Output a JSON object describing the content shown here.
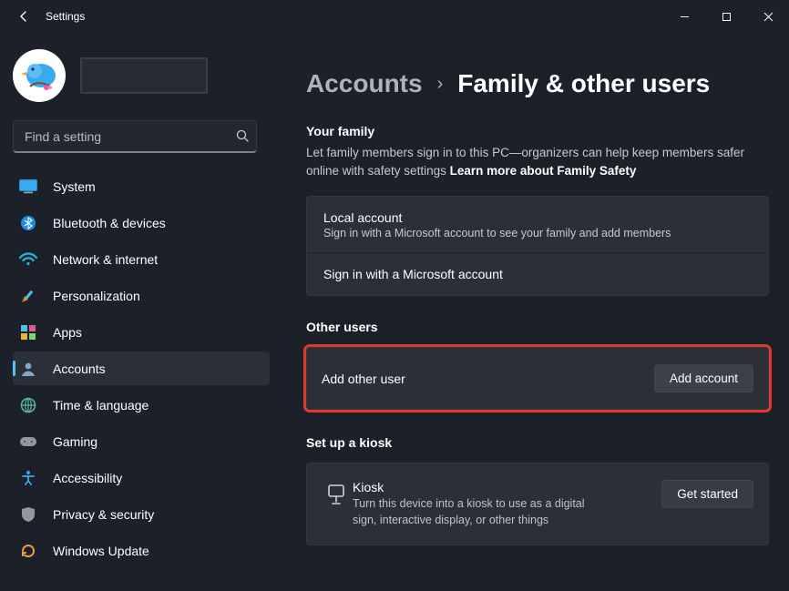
{
  "window": {
    "title": "Settings"
  },
  "search": {
    "placeholder": "Find a setting"
  },
  "nav": {
    "items": [
      {
        "label": "System"
      },
      {
        "label": "Bluetooth & devices"
      },
      {
        "label": "Network & internet"
      },
      {
        "label": "Personalization"
      },
      {
        "label": "Apps"
      },
      {
        "label": "Accounts"
      },
      {
        "label": "Time & language"
      },
      {
        "label": "Gaming"
      },
      {
        "label": "Accessibility"
      },
      {
        "label": "Privacy & security"
      },
      {
        "label": "Windows Update"
      }
    ]
  },
  "breadcrumb": {
    "parent": "Accounts",
    "current": "Family & other users"
  },
  "family": {
    "heading": "Your family",
    "desc": "Let family members sign in to this PC—organizers can help keep members safer online with safety settings  ",
    "learn_more": "Learn more about Family Safety",
    "local_title": "Local account",
    "local_sub": "Sign in with a Microsoft account to see your family and add members",
    "signin_link": "Sign in with a Microsoft account"
  },
  "other": {
    "heading": "Other users",
    "row_label": "Add other user",
    "button": "Add account"
  },
  "kiosk": {
    "heading": "Set up a kiosk",
    "title": "Kiosk",
    "desc": "Turn this device into a kiosk to use as a digital sign, interactive display, or other things",
    "button": "Get started"
  }
}
